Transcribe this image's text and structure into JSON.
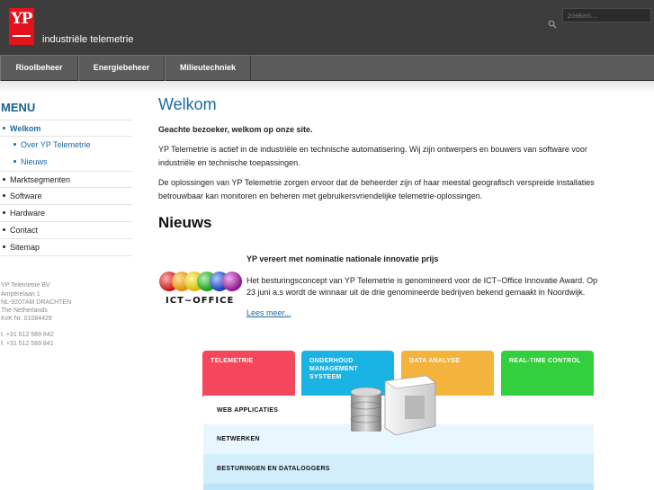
{
  "header": {
    "logo_text": "YP",
    "tagline": "industriële telemetrie",
    "search_placeholder": "zoeken..."
  },
  "nav": {
    "items": [
      {
        "label": "Rioolbeheer"
      },
      {
        "label": "Energiebeheer"
      },
      {
        "label": "Milieutechniek"
      }
    ]
  },
  "sidebar": {
    "menu_title": "MENU",
    "items": [
      {
        "label": "Welkom"
      },
      {
        "label": "Over YP Telemetrie"
      },
      {
        "label": "Nieuws"
      },
      {
        "label": "Marktsegmenten"
      },
      {
        "label": "Software"
      },
      {
        "label": "Hardware"
      },
      {
        "label": "Contact"
      },
      {
        "label": "Sitemap"
      }
    ],
    "address": {
      "line1": "YP Telemetrie BV",
      "line2": "Ampèrelaan 1",
      "line3": "NL-9207AM DRACHTEN",
      "line4": "The Netherlands",
      "line5": "KvK Nr. 01084429",
      "tel": "t. +31 512 589 842",
      "fax": "f. +31 512 589 841"
    }
  },
  "main": {
    "title": "Welkom",
    "lead": "Geachte bezoeker, welkom op onze site.",
    "para1_line1": "YP Telemetrie is actief in de industriële en technische automatisering. Wij zijn ontwerpers en bouwers van software voor",
    "para1_line2": "industriële en technische toepassingen.",
    "para2_line1": "De oplossingen van YP Telemetrie zorgen ervoor dat de beheerder zijn of haar meestal geografisch verspreide installaties",
    "para2_line2": "betrouwbaar kan monitoren en beheren met gebruikersvriendelijke telemetrie-oplossingen.",
    "news_heading": "Nieuws",
    "news": {
      "title": "YP vereert met nominatie nationale innovatie prijs",
      "body_line1": "Het besturingsconcept van YP  Telemetrie is genomineerd voor de ICT~Office Innovatie Award. Op",
      "body_line2": "23 juni a.s wordt de winnaar uit de drie genomineerde bedrijven bekend gemaakt in Noordwijk.",
      "link": "Lees meer...",
      "logo_text": "ICT~OFFICE"
    }
  },
  "diagram": {
    "tiles": [
      {
        "label": "TELEMETRIE",
        "color": "#f4475e"
      },
      {
        "label": "ONDERHOUD MANAGEMENT SYSTEEM",
        "color": "#1ab4e4"
      },
      {
        "label": "DATA ANALYSE",
        "color": "#f4b33c"
      },
      {
        "label": "REAL-TIME CONTROL",
        "color": "#32d03c"
      }
    ],
    "layers": [
      {
        "label": "WEB APPLICATIES"
      },
      {
        "label": "NETWERKEN"
      },
      {
        "label": "BESTURINGEN EN DATALOGGERS"
      }
    ]
  },
  "colors": {
    "header_bg": "#3d3d3d",
    "nav_bg": "#5b5b5b",
    "accent": "#1a6aa0",
    "logo_red": "#e3121b"
  }
}
